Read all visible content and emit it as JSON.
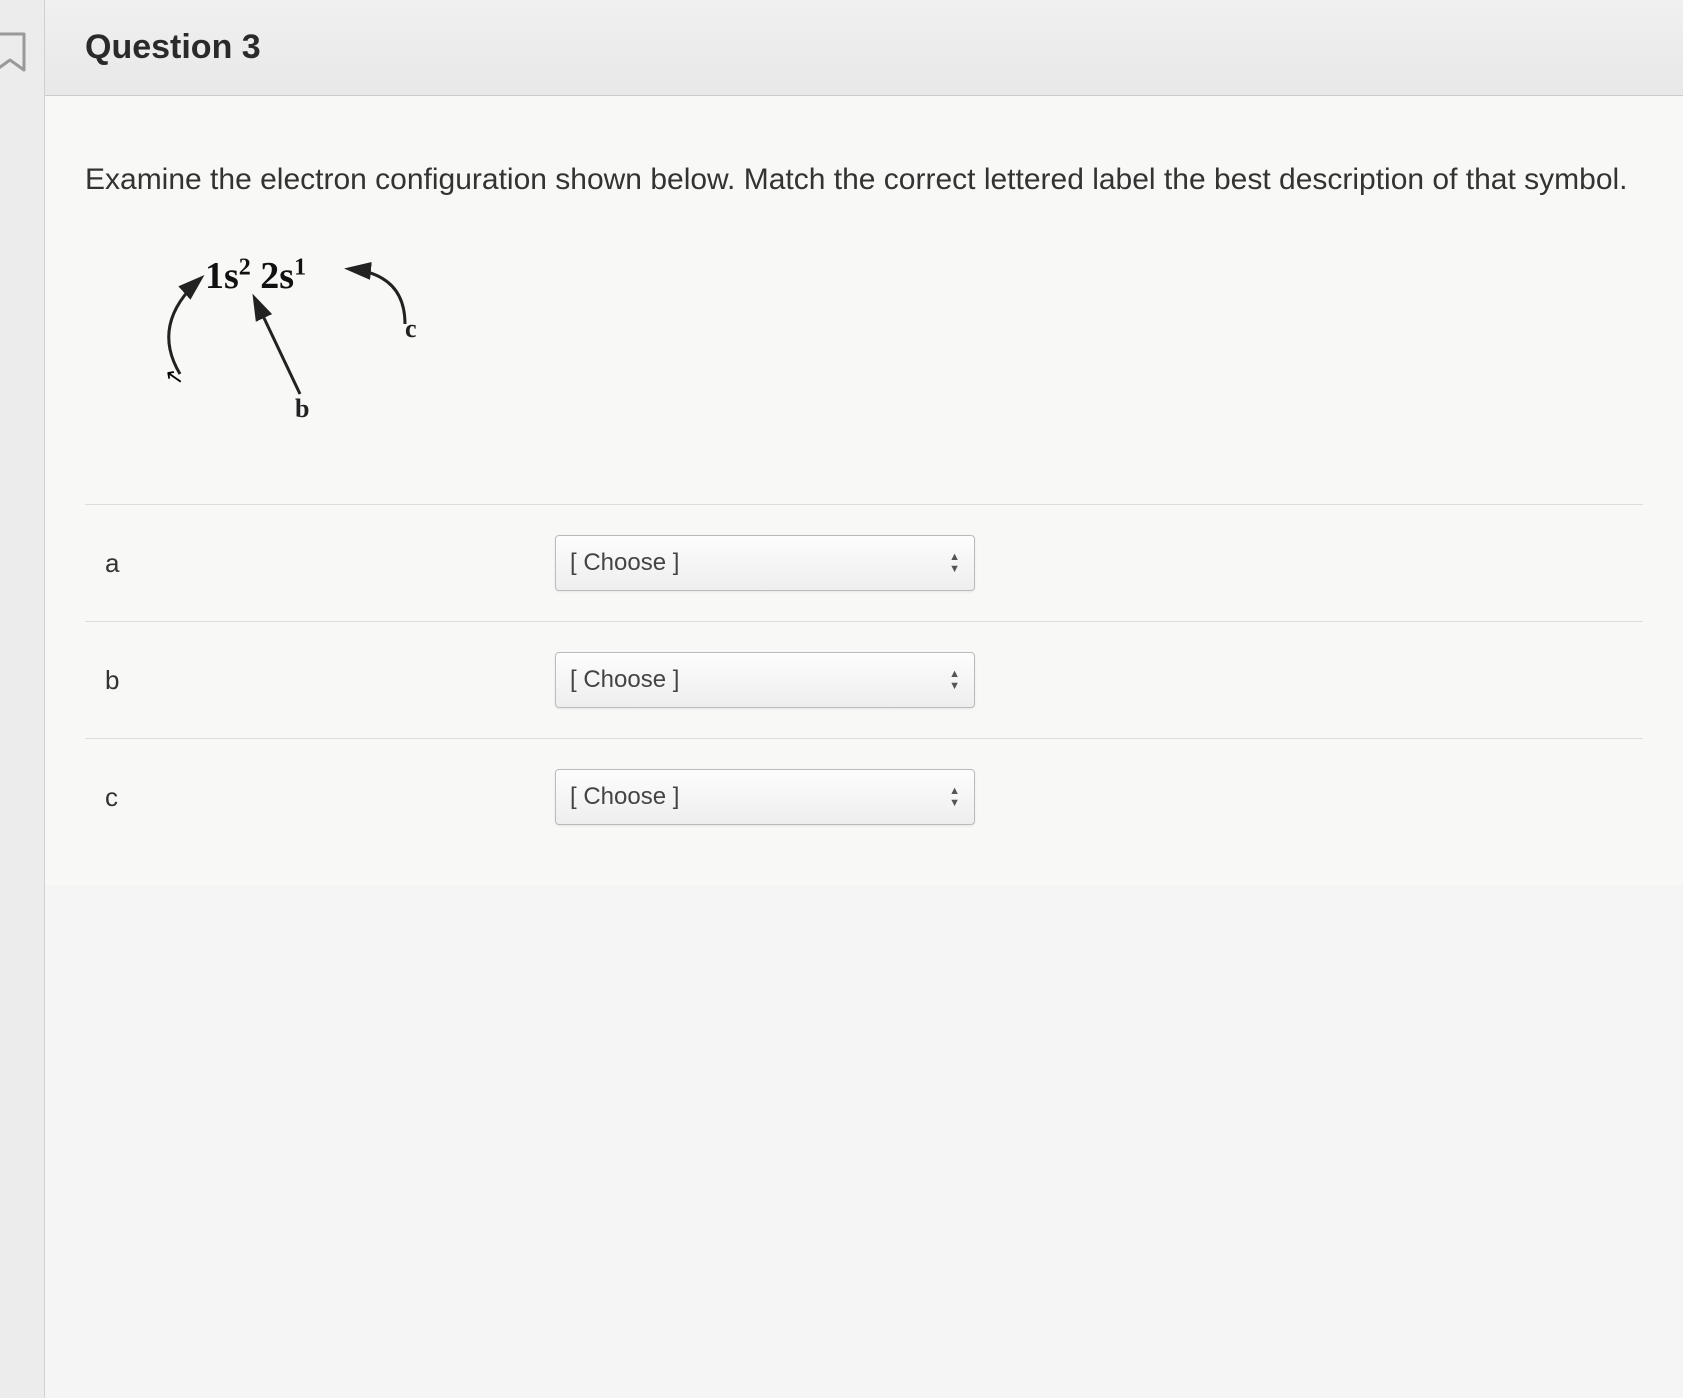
{
  "header": {
    "title": "Question 3"
  },
  "prompt": "Examine the electron configuration shown below.  Match the correct lettered label the best description of that symbol.",
  "diagram": {
    "config_pt1": "1s",
    "config_sup1": "2",
    "config_pt2": " 2s",
    "config_sup2": "1",
    "label_b": "b",
    "label_c": "c"
  },
  "rows": [
    {
      "label": "a",
      "value": "[ Choose ]"
    },
    {
      "label": "b",
      "value": "[ Choose ]"
    },
    {
      "label": "c",
      "value": "[ Choose ]"
    }
  ]
}
